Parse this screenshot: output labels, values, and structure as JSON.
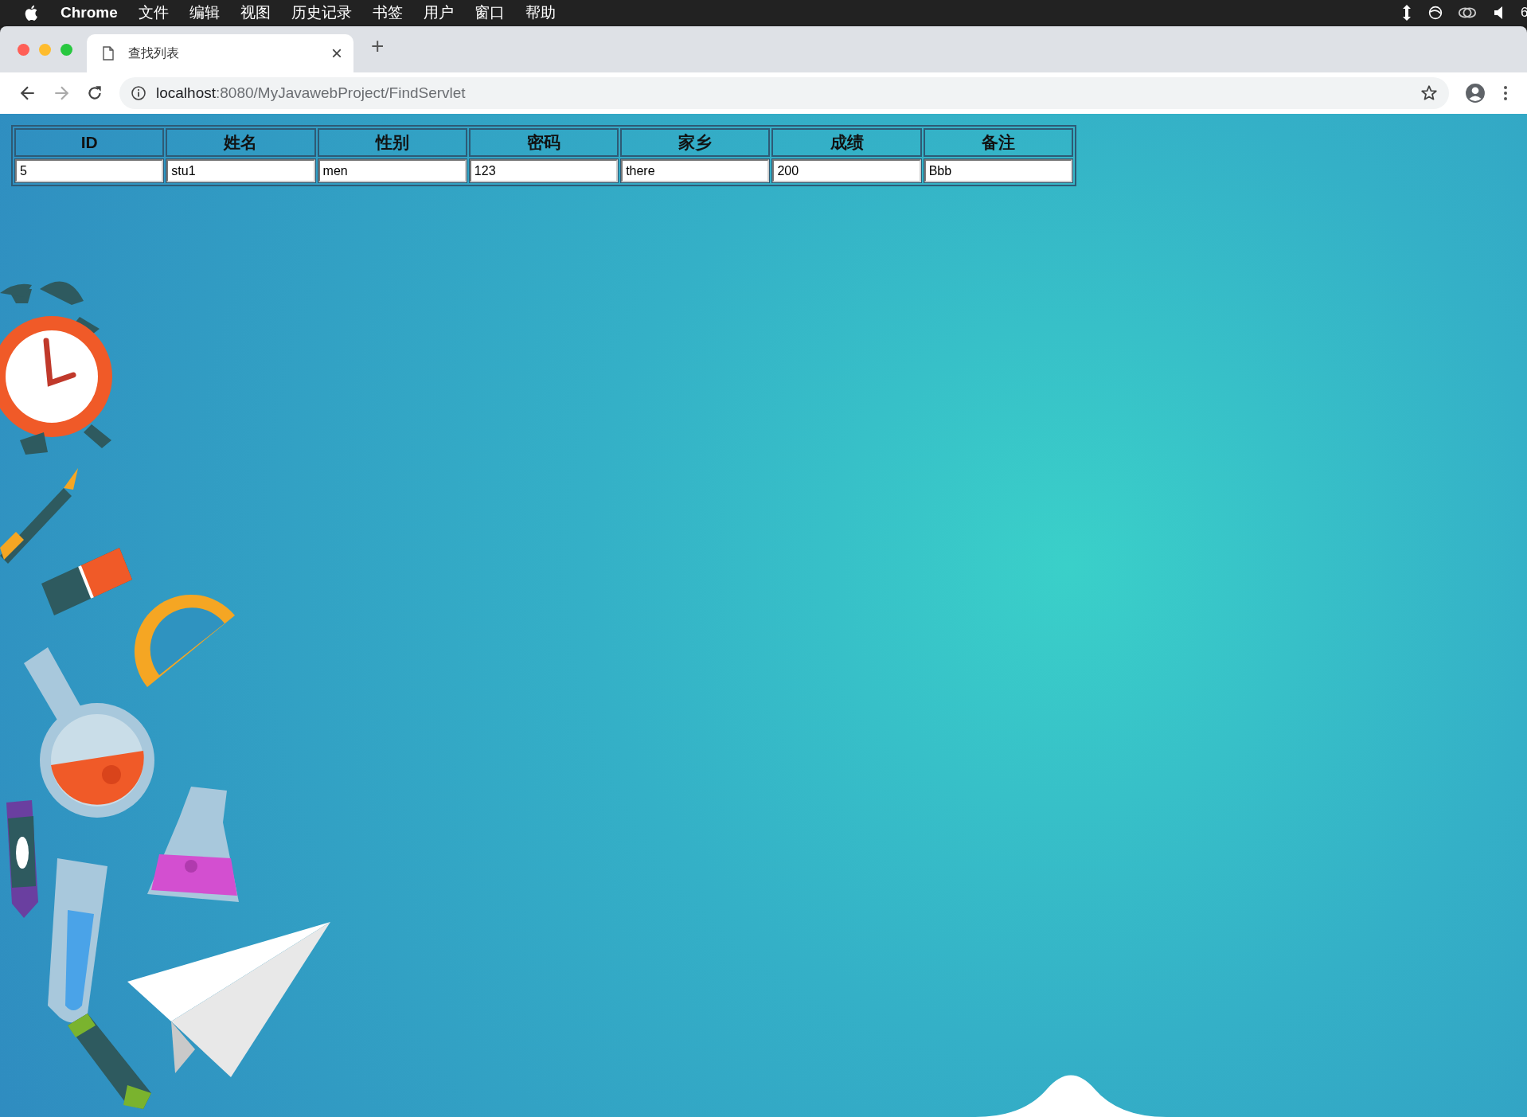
{
  "menu_bar": {
    "app_name": "Chrome",
    "items": [
      "文件",
      "编辑",
      "视图",
      "历史记录",
      "书签",
      "用户",
      "窗口",
      "帮助"
    ],
    "clock_fragment": "6"
  },
  "tabs": [
    {
      "title": "查找列表",
      "selected": true,
      "close": "×"
    }
  ],
  "new_tab": "+",
  "address_bar": {
    "host": "localhost",
    "path": ":8080/MyJavawebProject/FindServlet"
  },
  "table": {
    "columns": [
      "ID",
      "姓名",
      "性别",
      "密码",
      "家乡",
      "成绩",
      "备注"
    ],
    "rows": [
      [
        "5",
        "stu1",
        "men",
        "123",
        "there",
        "200",
        "Bbb"
      ]
    ]
  }
}
